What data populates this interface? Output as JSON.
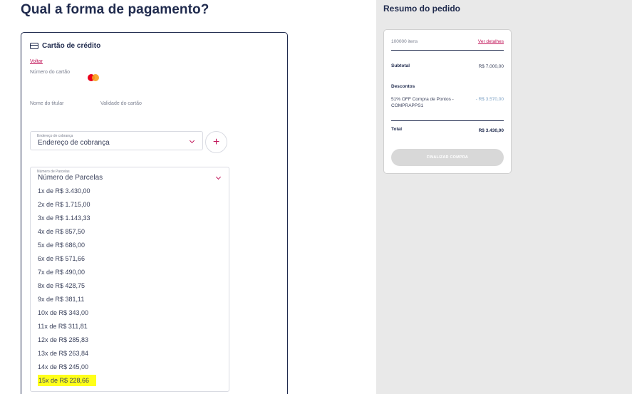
{
  "page": {
    "title": "Qual a forma de pagamento?"
  },
  "card_form": {
    "title": "Cartão de crédito",
    "back_link": "Voltar",
    "card_number_label": "Número do cartão",
    "holder_name_label": "Nome do titular",
    "expiry_label": "Validade do cartão",
    "card_brand_icon": "mastercard-icon",
    "billing_address": {
      "float_label": "Endereço de cobrança",
      "value": "Endereço de cobrança"
    },
    "add_address_icon": "+",
    "installments": {
      "float_label": "Número de Parcelas",
      "value": "Número de Parcelas",
      "options": [
        "1x de R$ 3.430,00",
        "2x de R$ 1.715,00",
        "3x de R$ 1.143,33",
        "4x de R$ 857,50",
        "5x de R$ 686,00",
        "6x de R$ 571,66",
        "7x de R$ 490,00",
        "8x de R$ 428,75",
        "9x de R$ 381,11",
        "10x de R$ 343,00",
        "11x de R$ 311,81",
        "12x de R$ 285,83",
        "13x de R$ 263,84",
        "14x de R$ 245,00",
        "15x de R$ 228,66"
      ],
      "highlighted_option": "15x de R$ 228,66",
      "highlight_color": "#ffff1a"
    }
  },
  "summary": {
    "title": "Resumo do pedido",
    "items_count": "100000 itens",
    "details_link": "Ver detalhes",
    "subtotal_label": "Subtotal",
    "subtotal_value": "R$ 7.000,00",
    "discounts_label": "Descontos",
    "discount_description_line1": "51% OFF Compra de Pontos -",
    "discount_description_line2": "COMPRAPPS1",
    "discount_value": "- R$ 3.570,00",
    "total_label": "Total",
    "total_value": "R$ 3.430,00",
    "finish_button": "FINALIZAR COMPRA"
  },
  "colors": {
    "primary_text": "#1f2a4d",
    "accent": "#c2185b",
    "sidebar_bg": "#e9e9e9",
    "disabled_button": "#d8d8d8"
  }
}
